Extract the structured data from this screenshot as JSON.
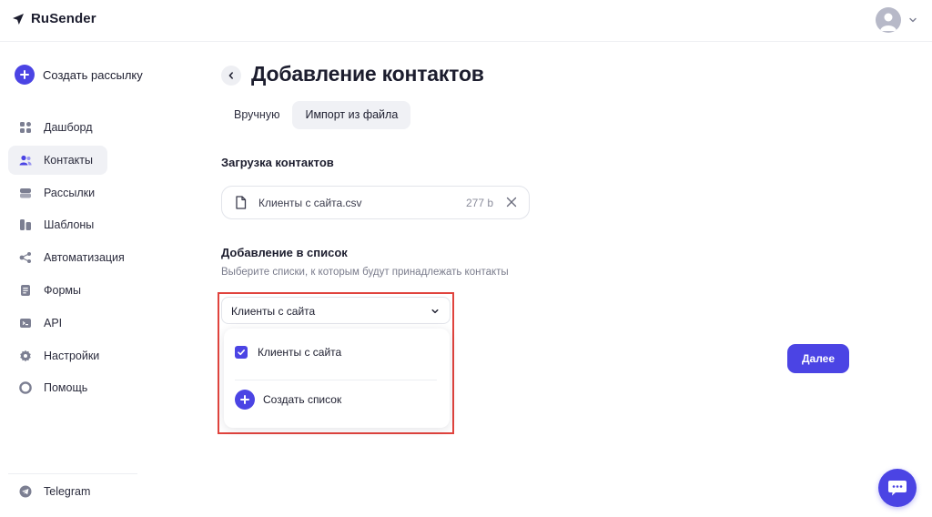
{
  "app": {
    "brand": "RuSender"
  },
  "sidebar": {
    "create_label": "Создать рассылку",
    "items": [
      {
        "label": "Дашборд",
        "icon": "dashboard-icon",
        "active": false
      },
      {
        "label": "Контакты",
        "icon": "contacts-icon",
        "active": true
      },
      {
        "label": "Рассылки",
        "icon": "mailings-icon",
        "active": false
      },
      {
        "label": "Шаблоны",
        "icon": "templates-icon",
        "active": false
      },
      {
        "label": "Автоматизация",
        "icon": "automation-icon",
        "active": false
      },
      {
        "label": "Формы",
        "icon": "forms-icon",
        "active": false
      },
      {
        "label": "API",
        "icon": "api-icon",
        "active": false
      },
      {
        "label": "Настройки",
        "icon": "gear-icon",
        "active": false
      },
      {
        "label": "Помощь",
        "icon": "help-icon",
        "active": false
      }
    ],
    "telegram_label": "Telegram"
  },
  "page": {
    "title": "Добавление контактов",
    "tabs": [
      {
        "label": "Вручную",
        "active": false
      },
      {
        "label": "Импорт из файла",
        "active": true
      }
    ]
  },
  "upload": {
    "title": "Загрузка контактов",
    "file_name": "Клиенты с сайта.csv",
    "file_size": "277 b"
  },
  "list": {
    "title": "Добавление в список",
    "subtitle": "Выберите списки, к которым будут принадлежать контакты",
    "selected_value": "Клиенты с сайта",
    "options": [
      {
        "label": "Клиенты с сайта",
        "checked": true
      }
    ],
    "create_label": "Создать список"
  },
  "actions": {
    "next_label": "Далее"
  },
  "colors": {
    "accent": "#4b44e4",
    "highlight": "#e0433d",
    "icon_gray": "#7c7f92"
  }
}
